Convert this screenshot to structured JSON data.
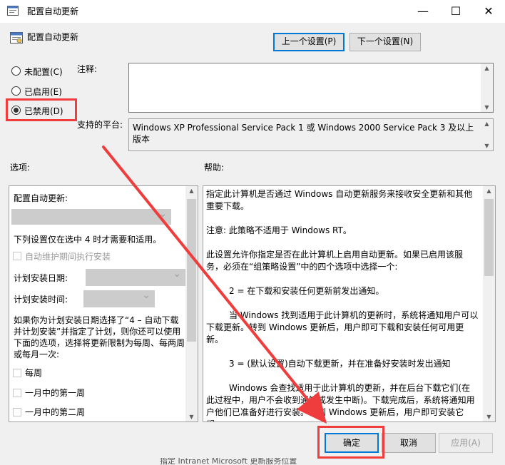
{
  "window": {
    "title": "配置自动更新",
    "header_title": "配置自动更新",
    "buttons": {
      "minimize": "—",
      "maximize": "☐",
      "close": "✕"
    }
  },
  "nav": {
    "prev": "上一个设置(P)",
    "next": "下一个设置(N)"
  },
  "state": {
    "options": [
      {
        "label": "未配置(C)",
        "selected": false
      },
      {
        "label": "已启用(E)",
        "selected": false
      },
      {
        "label": "已禁用(D)",
        "selected": true
      }
    ]
  },
  "labels": {
    "comment": "注释:",
    "supported": "支持的平台:",
    "options": "选项:",
    "help": "帮助:"
  },
  "supported_value": "Windows XP Professional Service Pack 1 或 Windows 2000 Service Pack 3 及以上版本",
  "options_panel": {
    "configure_label": "配置自动更新:",
    "required_note": "下列设置仅在选中 4 时才需要和适用。",
    "maintenance_checkbox": "自动维护期间执行安装",
    "install_day_label": "计划安装日期:",
    "install_time_label": "计划安装时间:",
    "paragraph": "如果你为计划安装日期选择了“4 – 自动下载并计划安装”并指定了计划，则你还可以使用下面的选项，选择将更新限制为每周、每两周或每月一次:",
    "weekly": "每周",
    "first_week": "一月中的第一周",
    "second_week": "一月中的第二周"
  },
  "help_text": {
    "p1": "指定此计算机是否通过 Windows 自动更新服务来接收安全更新和其他重要下载。",
    "p2": "注意: 此策略不适用于 Windows RT。",
    "p3": "此设置允许你指定是否在此计算机上启用自动更新。如果已启用该服务，必须在“组策略设置”中的四个选项中选择一个:",
    "p4": "2 = 在下载和安装任何更新前发出通知。",
    "p5": "当 Windows 找到适用于此计算机的更新时，系统将通知用户可以下载更新。转到 Windows 更新后，用户即可下载和安装任何可用更新。",
    "p6": "3 = (默认设置)自动下载更新，并在准备好安装时发出通知",
    "p7": "Windows 会查找适用于此计算机的更新，并在后台下载它们(在此过程中，用户不会收到通知或发生中断)。下载完成后，系统将通知用户他们已准备好进行安装。转到 Windows 更新后，用户即可安装它们。"
  },
  "footer": {
    "ok": "确定",
    "cancel": "取消",
    "apply": "应用(A)"
  },
  "background_hint": "指定 Intranet Microsoft 更新服务位置",
  "colors": {
    "annotation_red": "#ef3c3c",
    "focus_blue": "#0078d7"
  }
}
